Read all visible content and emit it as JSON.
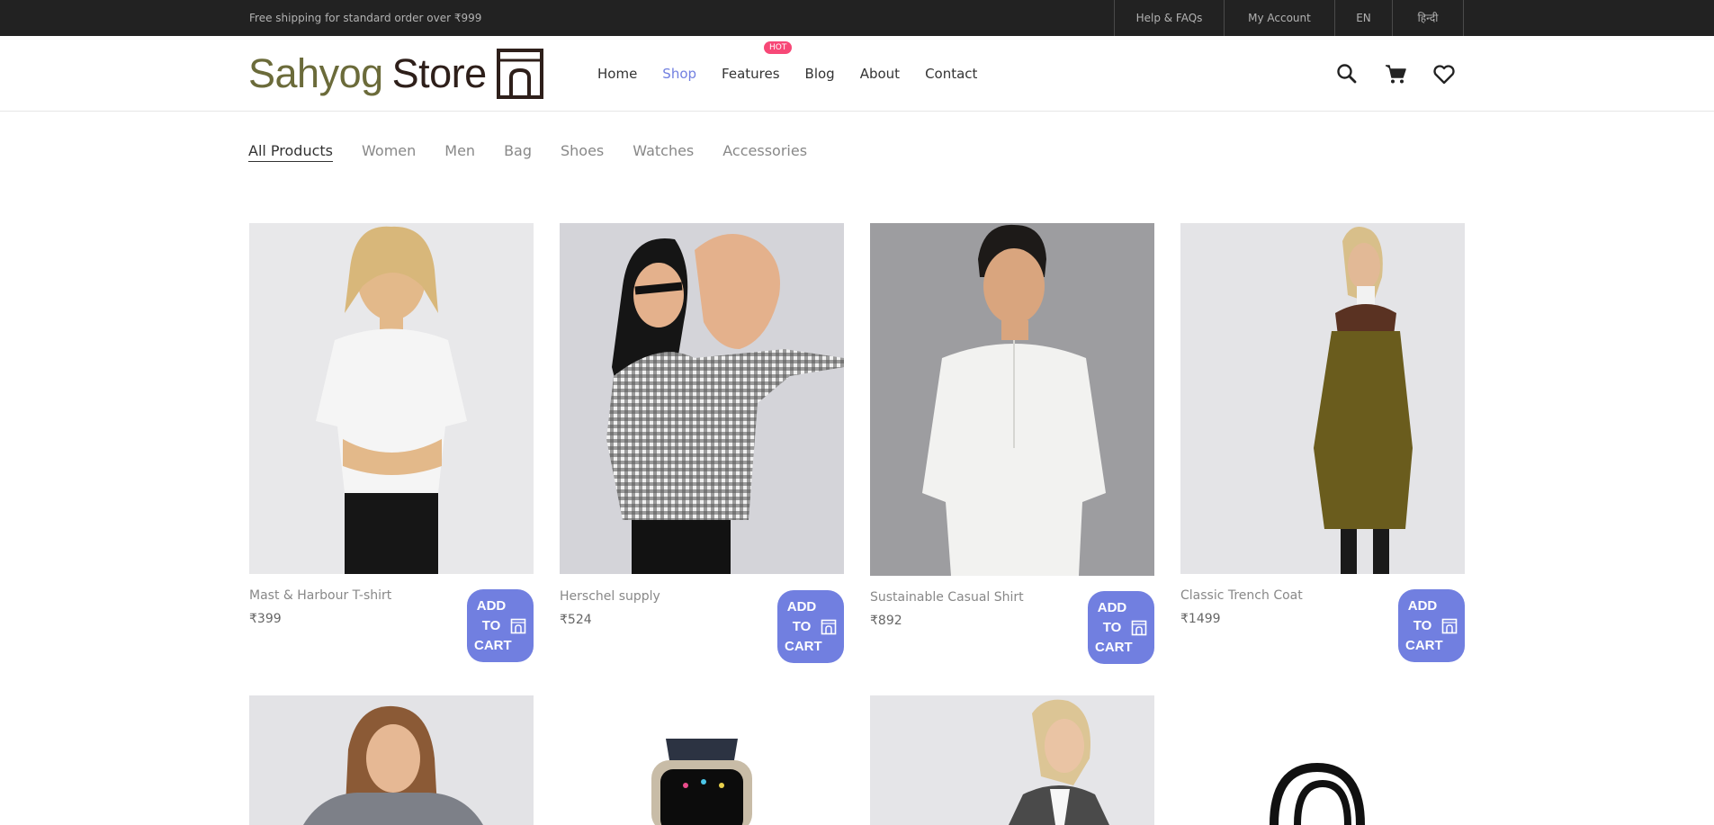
{
  "topbar": {
    "promo": "Free shipping for standard order over ₹999",
    "links": [
      "Help & FAQs",
      "My Account",
      "EN",
      "हिन्दी"
    ]
  },
  "brand": {
    "word1": "Sahyog",
    "word2": "Store"
  },
  "nav": {
    "items": [
      "Home",
      "Shop",
      "Features",
      "Blog",
      "About",
      "Contact"
    ],
    "active": "Shop",
    "badge": "HOT"
  },
  "header_icons": [
    "search-icon",
    "cart-icon",
    "heart-icon"
  ],
  "filters": {
    "items": [
      "All Products",
      "Women",
      "Men",
      "Bag",
      "Shoes",
      "Watches",
      "Accessories"
    ],
    "active": "All Products"
  },
  "add_to_cart_label": [
    "ADD",
    "TO",
    "CART"
  ],
  "products": [
    {
      "name": "Mast & Harbour T-shirt",
      "price": "₹399"
    },
    {
      "name": "Herschel supply",
      "price": "₹524"
    },
    {
      "name": "Sustainable Casual Shirt",
      "price": "₹892"
    },
    {
      "name": "Classic Trench Coat",
      "price": "₹1499"
    }
  ],
  "colors": {
    "accent": "#717fe0",
    "hot_badge": "#f74877",
    "topbar": "#222222",
    "logo_olive": "#6b6b3a",
    "logo_brown": "#2e1f1a"
  }
}
